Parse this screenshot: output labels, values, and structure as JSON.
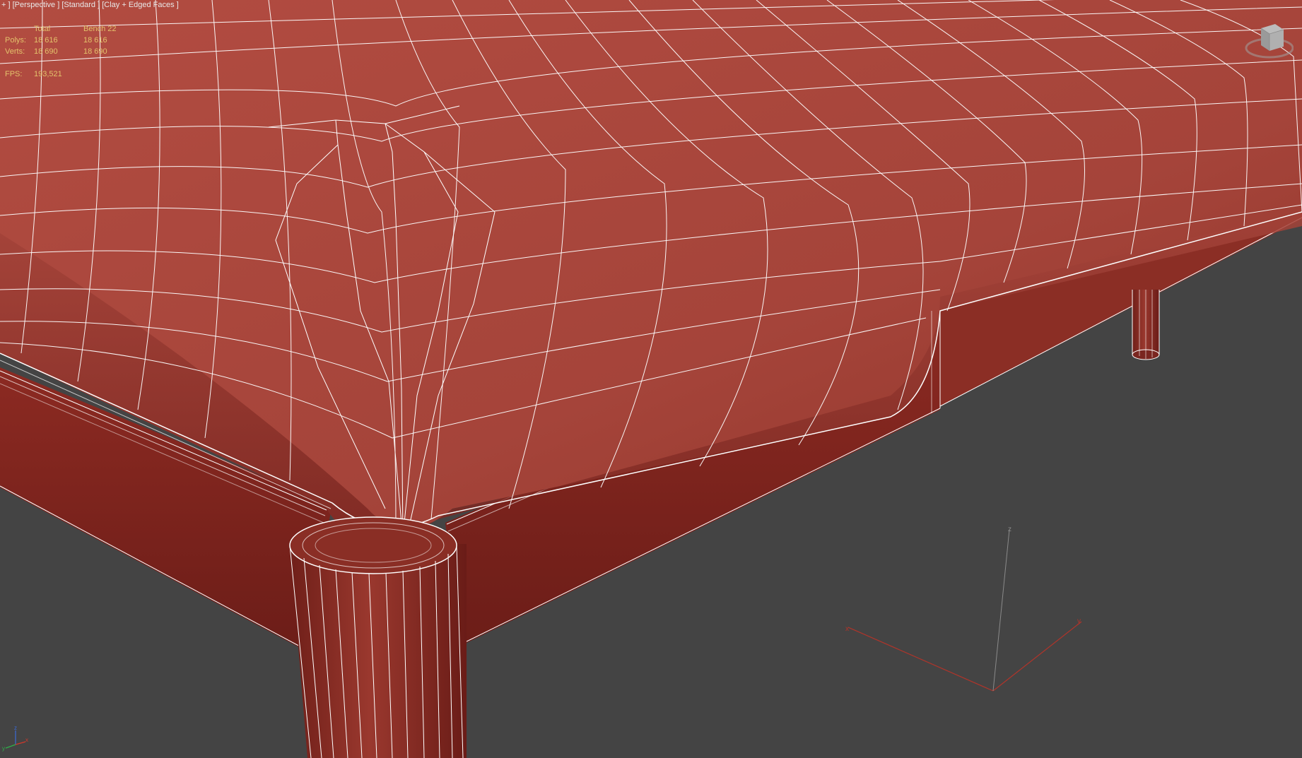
{
  "viewport": {
    "label_parts": [
      "+",
      "Perspective",
      "Standard",
      "Clay + Edged Faces"
    ],
    "stats": {
      "headers": [
        "",
        "Total",
        "Bench 22"
      ],
      "rows": [
        {
          "label": "Polys:",
          "total": "18 616",
          "object": "18 616"
        },
        {
          "label": "Verts:",
          "total": "18 690",
          "object": "18 690"
        }
      ],
      "fps_label": "FPS:",
      "fps_value": "193,521"
    }
  },
  "scene": {
    "object_color": "#8e3328",
    "wire_color": "#ffffff",
    "background_color": "#444444",
    "gizmo_colors": {
      "x": "#c0392b",
      "y": "#c0392b",
      "z": "#8a8a8a"
    }
  },
  "icons": {
    "viewcube": "viewcube-icon",
    "axis_tripod": "axis-tripod-icon",
    "transform_gizmo": "transform-gizmo-icon"
  }
}
